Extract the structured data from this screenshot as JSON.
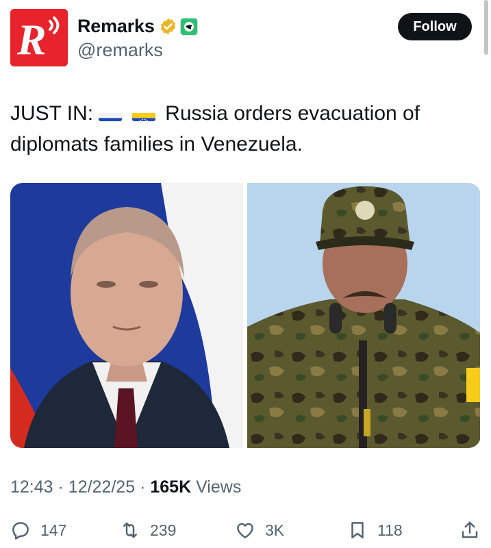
{
  "author": {
    "name": "Remarks",
    "handle": "@remarks",
    "avatar_letter": "R",
    "avatar_color": "#e8232b",
    "verified_badge_color": "#e8b82a",
    "affiliate_badge_color": "#2dbf73"
  },
  "follow_label": "Follow",
  "tweet": {
    "prefix": "JUST IN:",
    "flags": [
      "russia-flag",
      "venezuela-flag"
    ],
    "text": "Russia orders evacuation of diplomats families in Venezuela."
  },
  "media": [
    {
      "name": "photo-man-suit",
      "background": "Russian flag"
    },
    {
      "name": "photo-man-military-cap",
      "background": "sky"
    }
  ],
  "meta": {
    "time": "12:43",
    "date": "12/22/25",
    "views_count": "165K",
    "views_label": "Views"
  },
  "actions": {
    "replies": "147",
    "reposts": "239",
    "likes": "3K",
    "bookmarks": "118"
  },
  "colors": {
    "text": "#0f1419",
    "secondary": "#536471",
    "follow_bg": "#0f1419"
  }
}
